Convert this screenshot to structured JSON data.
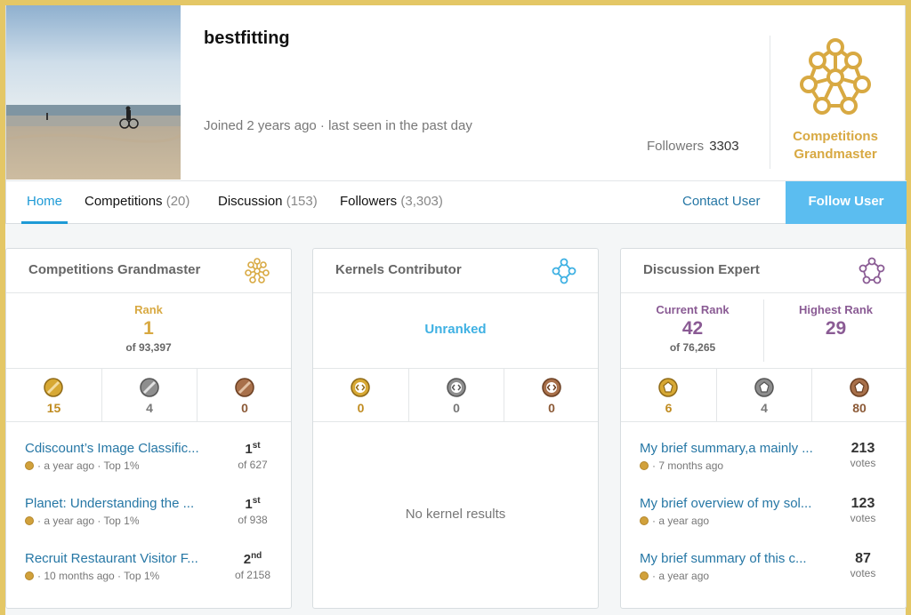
{
  "profile": {
    "username": "bestfitting",
    "joined": "Joined 2 years ago · last seen in the past day",
    "followers_label": "Followers",
    "followers_count": "3303",
    "tier_line1": "Competitions",
    "tier_line2": "Grandmaster"
  },
  "tabs": [
    {
      "label": "Home",
      "count": ""
    },
    {
      "label": "Competitions",
      "count": "(20)"
    },
    {
      "label": "Discussion",
      "count": "(153)"
    },
    {
      "label": "Followers",
      "count": "(3,303)"
    }
  ],
  "actions": {
    "contact": "Contact User",
    "follow": "Follow User"
  },
  "competitions": {
    "title": "Competitions Grandmaster",
    "rank_label": "Rank",
    "rank": "1",
    "rank_of": "of 93,397",
    "medals": {
      "gold": "15",
      "silver": "4",
      "bronze": "0"
    },
    "items": [
      {
        "title": "Cdiscount’s Image Classific...",
        "meta": "· a year ago · Top 1%",
        "place": "1",
        "suffix": "st",
        "of": "of 627"
      },
      {
        "title": "Planet: Understanding the ...",
        "meta": "· a year ago · Top 1%",
        "place": "1",
        "suffix": "st",
        "of": "of 938"
      },
      {
        "title": "Recruit Restaurant Visitor F...",
        "meta": "· 10 months ago · Top 1%",
        "place": "2",
        "suffix": "nd",
        "of": "of 2158"
      }
    ]
  },
  "kernels": {
    "title": "Kernels Contributor",
    "rank": "Unranked",
    "medals": {
      "gold": "0",
      "silver": "0",
      "bronze": "0"
    },
    "empty": "No kernel results"
  },
  "discussion": {
    "title": "Discussion Expert",
    "current_label": "Current Rank",
    "current": "42",
    "current_of": "of 76,265",
    "highest_label": "Highest Rank",
    "highest": "29",
    "medals": {
      "gold": "6",
      "silver": "4",
      "bronze": "80"
    },
    "items": [
      {
        "title": "My brief summary,a mainly ...",
        "meta": "· 7 months ago",
        "votes": "213",
        "votes_label": "votes"
      },
      {
        "title": "My brief overview of my sol...",
        "meta": "· a year ago",
        "votes": "123",
        "votes_label": "votes"
      },
      {
        "title": "My brief summary of this c...",
        "meta": "· a year ago",
        "votes": "87",
        "votes_label": "votes"
      }
    ]
  },
  "colors": {
    "gold": "#d8a942",
    "blue": "#1e9ad6",
    "purple": "#8a5b94",
    "follow_btn": "#5bbdf0"
  }
}
